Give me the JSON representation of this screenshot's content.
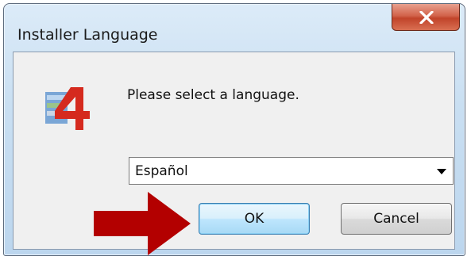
{
  "window": {
    "title": "Installer Language",
    "close_glyph": "X"
  },
  "dialog": {
    "prompt": "Please select a language.",
    "language_select": {
      "value": "Español"
    },
    "ok_label": "OK",
    "cancel_label": "Cancel"
  },
  "icons": {
    "app": "installer-app-icon",
    "annotation": "red-arrow-icon"
  },
  "colors": {
    "close_button": "#c1442a",
    "annotation_arrow": "#b30000",
    "ok_focus": "#3c7fb1"
  }
}
